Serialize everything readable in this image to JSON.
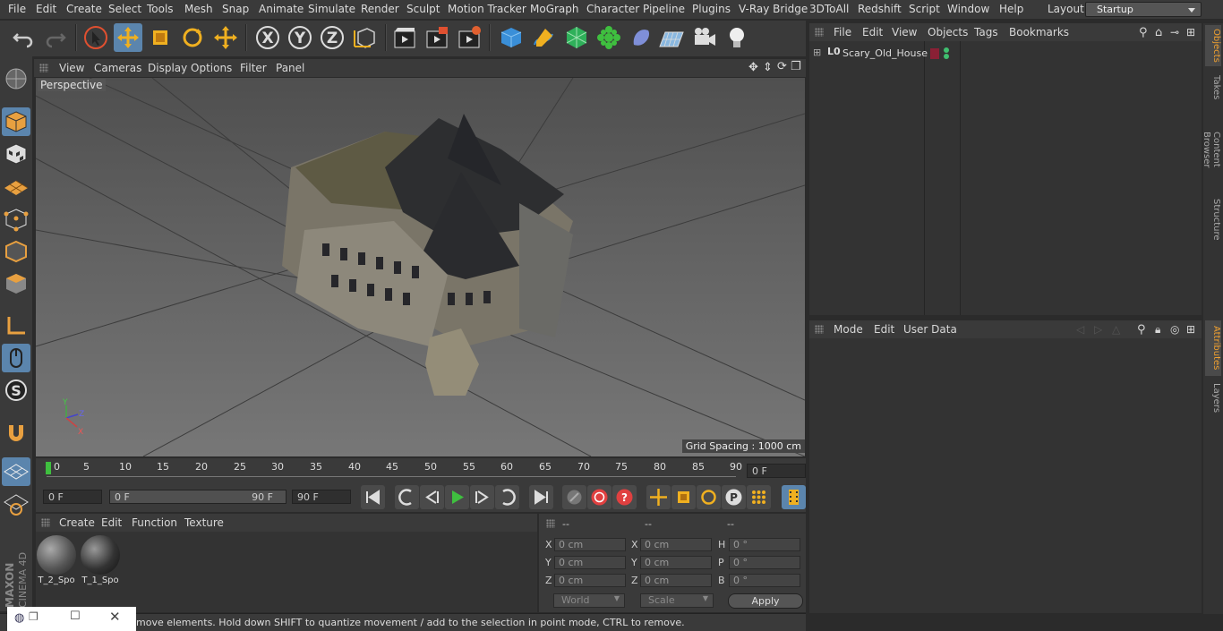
{
  "menubar": {
    "items": [
      "File",
      "Edit",
      "Create",
      "Select",
      "Tools",
      "Mesh",
      "Snap",
      "Animate",
      "Simulate",
      "Render",
      "Sculpt",
      "Motion Tracker",
      "MoGraph",
      "Character",
      "Pipeline",
      "Plugins",
      "V-Ray Bridge",
      "3DToAll",
      "Redshift",
      "Script",
      "Window",
      "Help"
    ],
    "layout_label": "Layout:",
    "layout_value": "Startup"
  },
  "viewport": {
    "menu": [
      "View",
      "Cameras",
      "Display",
      "Options",
      "Filter",
      "Panel"
    ],
    "name": "Perspective",
    "grid_spacing": "Grid Spacing : 1000 cm",
    "axis": {
      "x": "X",
      "y": "Y",
      "z": "Z"
    }
  },
  "timeline": {
    "ticks": [
      "0",
      "5",
      "10",
      "15",
      "20",
      "25",
      "30",
      "35",
      "40",
      "45",
      "50",
      "55",
      "60",
      "65",
      "70",
      "75",
      "80",
      "85",
      "90"
    ],
    "current_frame": "0 F",
    "start_field": "0 F",
    "range_start": "0 F",
    "range_end": "90 F",
    "end_field": "90 F"
  },
  "materials": {
    "menu": [
      "Create",
      "Edit",
      "Function",
      "Texture"
    ],
    "items": [
      {
        "label": "T_2_Spo"
      },
      {
        "label": "T_1_Spo"
      }
    ]
  },
  "coords": {
    "headers": [
      "--",
      "--",
      "--"
    ],
    "rows": [
      {
        "a": "X",
        "av": "0 cm",
        "b": "X",
        "bv": "0 cm",
        "c": "H",
        "cv": "0 °"
      },
      {
        "a": "Y",
        "av": "0 cm",
        "b": "Y",
        "bv": "0 cm",
        "c": "P",
        "cv": "0 °"
      },
      {
        "a": "Z",
        "av": "0 cm",
        "b": "Z",
        "bv": "0 cm",
        "c": "B",
        "cv": "0 °"
      }
    ],
    "space": "World",
    "mode": "Scale",
    "apply": "Apply"
  },
  "objects": {
    "menu": [
      "File",
      "Edit",
      "View",
      "Objects",
      "Tags",
      "Bookmarks"
    ],
    "items": [
      {
        "name": "Scary_Old_House",
        "tag_color": "#8a2035"
      }
    ]
  },
  "attributes": {
    "menu": [
      "Mode",
      "Edit",
      "User Data"
    ]
  },
  "right_tabs": [
    "Objects",
    "Takes",
    "Content Browser",
    "Structure",
    "Attributes",
    "Layers"
  ],
  "status": "move elements. Hold down SHIFT to quantize movement / add to the selection in point mode, CTRL to remove.",
  "logo": {
    "brand": "MAXON",
    "product": "CINEMA 4D"
  },
  "colors": {
    "accent": "#5b85ad",
    "play": "#3fbf3f",
    "record": "#e04040"
  }
}
